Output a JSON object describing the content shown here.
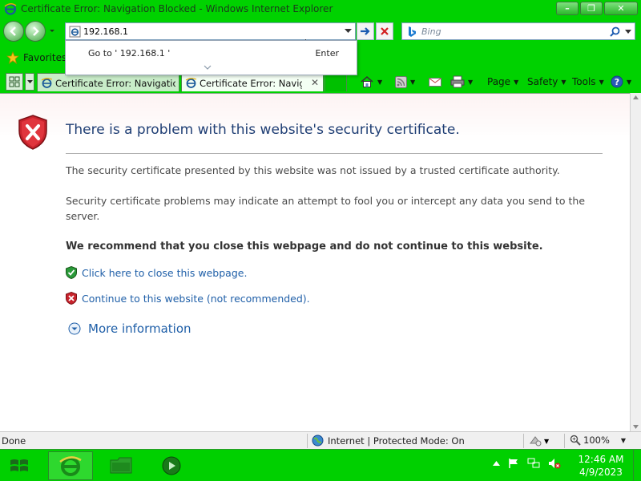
{
  "window": {
    "title": "Certificate Error: Navigation Blocked - Windows Internet Explorer",
    "minimize": "–",
    "maximize": "❐",
    "close": "✕"
  },
  "nav": {
    "address_value": "192.168.1",
    "search_placeholder": "Bing"
  },
  "autocomplete": {
    "goto_label": "Go to ' 192.168.1 '",
    "enter_label": "Enter"
  },
  "favorites": {
    "label": "Favorites"
  },
  "tabs": [
    {
      "label": "Certificate Error: Navigatio...",
      "active": false
    },
    {
      "label": "Certificate Error: Navig...",
      "active": true
    }
  ],
  "commands": {
    "page": "Page",
    "safety": "Safety",
    "tools": "Tools"
  },
  "content": {
    "heading": "There is a problem with this website's security certificate.",
    "para1": "The security certificate presented by this website was not issued by a trusted certificate authority.",
    "para2": "Security certificate problems may indicate an attempt to fool you or intercept any data you send to the server.",
    "recommend": "We recommend that you close this webpage and do not continue to this website.",
    "close_link": "Click here to close this webpage.",
    "continue_link": "Continue to this website (not recommended).",
    "more_info": "More information"
  },
  "status": {
    "text": "Done",
    "zone": "Internet | Protected Mode: On",
    "zoom": "100%"
  },
  "taskbar": {
    "time": "12:46 AM",
    "date": "4/9/2023"
  },
  "colors": {
    "chrome_green": "#00d200",
    "heading_blue": "#1f3e74",
    "link_blue": "#1f5fa8",
    "shield_red": "#c8232c"
  }
}
